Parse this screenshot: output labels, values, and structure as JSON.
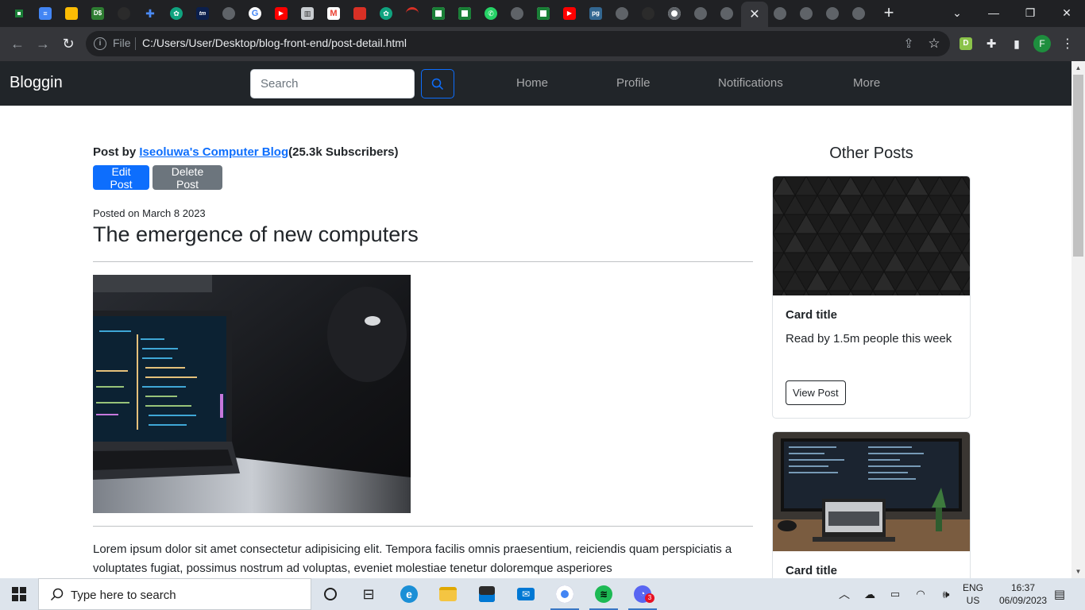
{
  "browser": {
    "url_scheme": "File",
    "url": "C:/Users/User/Desktop/blog-front-end/post-detail.html",
    "profile_initial": "F"
  },
  "navbar": {
    "brand": "Bloggin",
    "search_placeholder": "Search",
    "links": [
      "Home",
      "Profile",
      "Notifications",
      "More"
    ]
  },
  "post": {
    "by_prefix": "Post by ",
    "author": "Iseoluwa's Computer Blog",
    "subscribers": "(25.3k Subscribers)",
    "edit_label": "Edit Post",
    "delete_label": "Delete Post",
    "posted_on": "Posted on March 8 2023",
    "title": "The emergence of new computers",
    "body": "Lorem ipsum dolor sit amet consectetur adipisicing elit. Tempora facilis omnis praesentium, reiciendis quam perspiciatis a voluptates fugiat, possimus nostrum ad voluptas, eveniet molestiae tenetur doloremque asperiores"
  },
  "sidebar": {
    "title": "Other Posts",
    "cards": [
      {
        "title": "Card title",
        "text": "Read by 1.5m people this week",
        "button": "View Post"
      },
      {
        "title": "Card title"
      }
    ]
  },
  "taskbar": {
    "search_text": "Type here to search",
    "lang_line1": "ENG",
    "lang_line2": "US",
    "time": "16:37",
    "date": "06/09/2023",
    "notification_count": "3"
  },
  "colors": {
    "navbar_bg": "#212529",
    "primary": "#0d6efd",
    "secondary": "#6c757d",
    "chrome_dark": "#202124"
  }
}
